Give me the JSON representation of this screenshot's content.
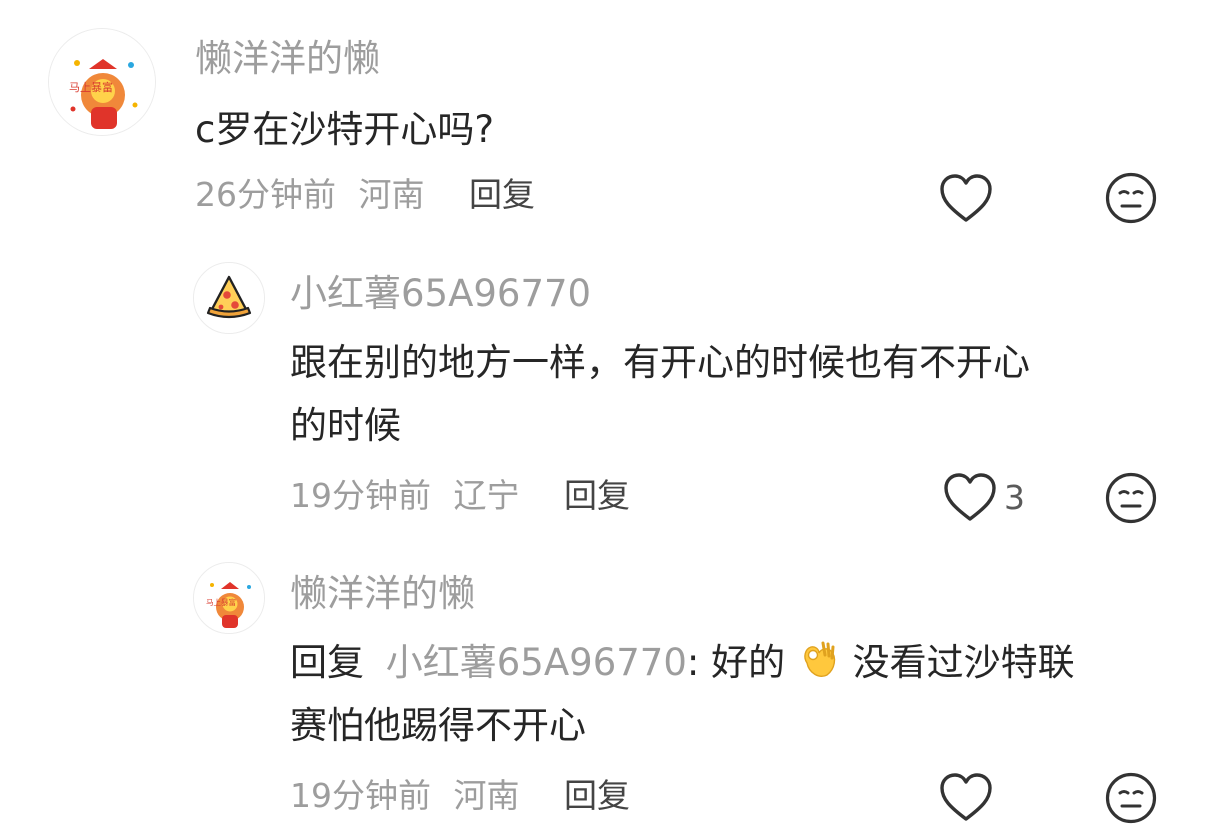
{
  "comments": [
    {
      "username": "懒洋洋的懒",
      "text": "c罗在沙特开心吗?",
      "time": "26分钟前",
      "location": "河南",
      "reply_label": "回复",
      "likes": "",
      "avatar_text": "马上暴富"
    },
    {
      "username": "小红薯65A96770",
      "text_line1": "跟在别的地方一样，有开心的时候也有不开心",
      "text_line2": "的时候",
      "time": "19分钟前",
      "location": "辽宁",
      "reply_label": "回复",
      "likes": "3"
    },
    {
      "username": "懒洋洋的懒",
      "reply_prefix": "回复",
      "mention": "小红薯65A96770",
      "text_after_mention": ": 好的",
      "text_after_emoji": "没看过沙特联",
      "text_line2": "赛怕他踢得不开心",
      "time": "19分钟前",
      "location": "河南",
      "reply_label": "回复",
      "likes": "",
      "avatar_text": "马上暴富"
    }
  ],
  "icons": {
    "like": "heart-outline-icon",
    "dislike": "meh-face-icon",
    "emoji": "ok-hand-emoji"
  },
  "colors": {
    "text": "#262626",
    "muted": "#9d9d9d",
    "icon": "#333333"
  }
}
